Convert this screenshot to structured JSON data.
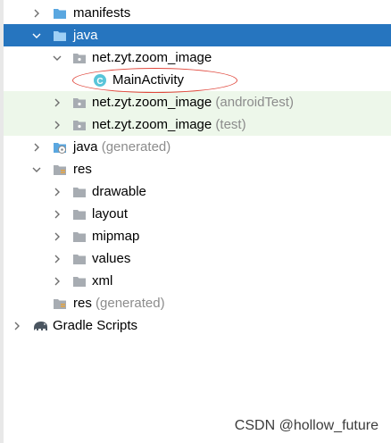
{
  "project_tree": {
    "items": [
      {
        "name": "manifests",
        "kind": "folder",
        "suffix": ""
      },
      {
        "name": "java",
        "kind": "folder",
        "suffix": ""
      },
      {
        "name": "net.zyt.zoom_image",
        "kind": "package",
        "suffix": ""
      },
      {
        "name": "MainActivity",
        "kind": "class",
        "suffix": "",
        "class_badge": "C"
      },
      {
        "name": "net.zyt.zoom_image",
        "kind": "package",
        "suffix": " (androidTest)"
      },
      {
        "name": "net.zyt.zoom_image",
        "kind": "package",
        "suffix": " (test)"
      },
      {
        "name": "java",
        "kind": "generated-folder",
        "suffix": " (generated)"
      },
      {
        "name": "res",
        "kind": "res-folder",
        "suffix": ""
      },
      {
        "name": "drawable",
        "kind": "folder-closed",
        "suffix": ""
      },
      {
        "name": "layout",
        "kind": "folder-closed",
        "suffix": ""
      },
      {
        "name": "mipmap",
        "kind": "folder-closed",
        "suffix": ""
      },
      {
        "name": "values",
        "kind": "folder-closed",
        "suffix": ""
      },
      {
        "name": "xml",
        "kind": "folder-closed",
        "suffix": ""
      },
      {
        "name": "res",
        "kind": "res-folder",
        "suffix": " (generated)"
      },
      {
        "name": "Gradle Scripts",
        "kind": "gradle",
        "suffix": ""
      }
    ]
  },
  "colors": {
    "selection": "#2675bf",
    "test_row_background": "#edf7ea",
    "folder_blue": "#5aa7e0",
    "highlight_ellipse": "#e0463b"
  },
  "watermark": "CSDN @hollow_future"
}
